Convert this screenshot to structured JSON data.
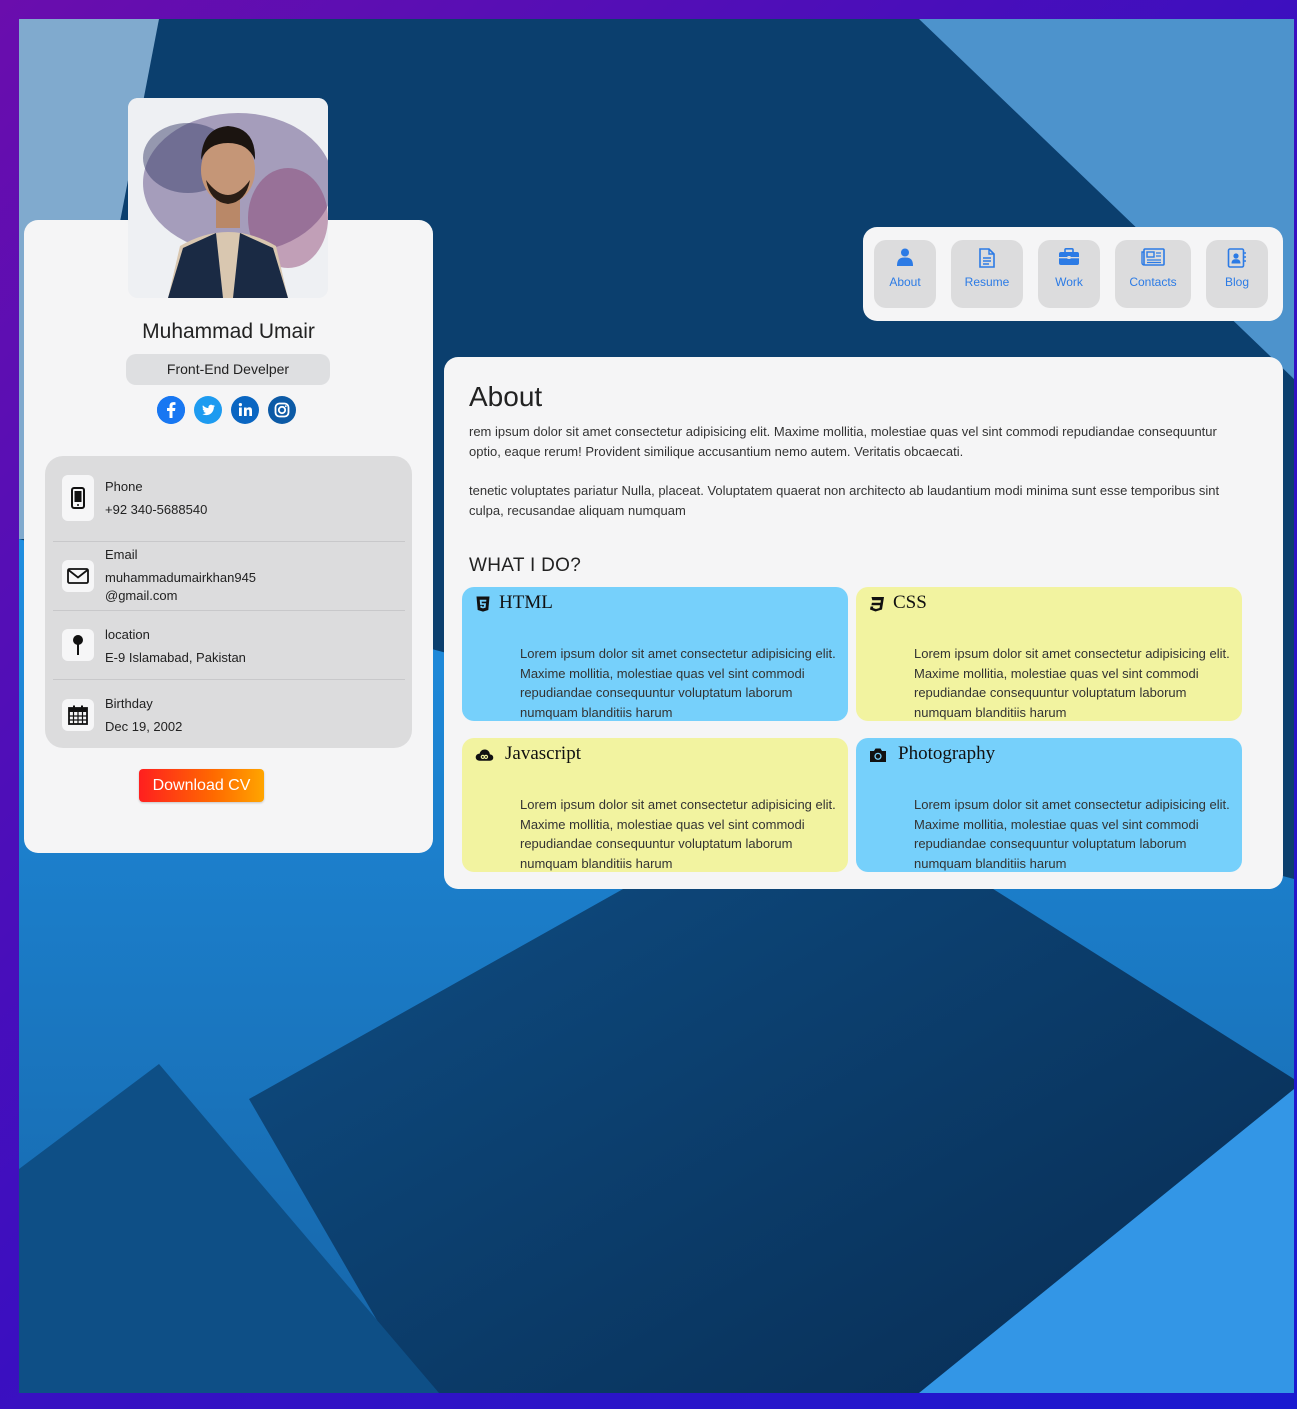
{
  "profile": {
    "name": "Muhammad Umair",
    "role": "Front-End Develper",
    "socials": [
      "facebook-icon",
      "twitter-icon",
      "linkedin-icon",
      "instagram-icon"
    ],
    "contacts": [
      {
        "label": "Phone",
        "value": "+92 340-5688540",
        "icon": "phone-icon"
      },
      {
        "label": "Email",
        "value": "muhammadumairkhan945\n@gmail.com",
        "icon": "envelope-icon"
      },
      {
        "label": "location",
        "value": "E-9 Islamabad, Pakistan",
        "icon": "map-pin-icon"
      },
      {
        "label": "Birthday",
        "value": "Dec 19, 2002",
        "icon": "calendar-icon"
      }
    ],
    "download_label": "Download CV"
  },
  "nav": {
    "items": [
      {
        "label": "About",
        "icon": "user-icon"
      },
      {
        "label": "Resume",
        "icon": "document-icon"
      },
      {
        "label": "Work",
        "icon": "briefcase-icon"
      },
      {
        "label": "Contacts",
        "icon": "newspaper-icon"
      },
      {
        "label": "Blog",
        "icon": "contact-book-icon"
      }
    ]
  },
  "about": {
    "title": "About",
    "para1": "rem ipsum dolor sit amet consectetur adipisicing elit. Maxime mollitia, molestiae quas vel sint commodi repudiandae consequuntur optio, eaque rerum! Provident similique accusantium nemo autem. Veritatis obcaecati.",
    "para2": "tenetic voluptates pariatur Nulla, placeat. Voluptatem quaerat non architecto ab laudantium modi minima sunt esse temporibus sint culpa, recusandae aliquam numquam",
    "whatido": "WHAT I DO?",
    "skills": [
      {
        "title": "HTML",
        "icon": "html5-icon",
        "text": "Lorem ipsum dolor sit amet consectetur adipisicing elit. Maxime mollitia, molestiae quas vel sint commodi repudiandae consequuntur voluptatum laborum numquam blanditiis harum",
        "color": "#76d0fb"
      },
      {
        "title": "CSS",
        "icon": "css3-icon",
        "text": "Lorem ipsum dolor sit amet consectetur adipisicing elit. Maxime mollitia, molestiae quas vel sint commodi repudiandae consequuntur voluptatum laborum numquam blanditiis harum",
        "color": "#f2f3a0"
      },
      {
        "title": "Javascript",
        "icon": "cloud-icon",
        "text": "Lorem ipsum dolor sit amet consectetur adipisicing elit. Maxime mollitia, molestiae quas vel sint commodi repudiandae consequuntur voluptatum laborum numquam blanditiis harum",
        "color": "#f2f3a0"
      },
      {
        "title": "Photography",
        "icon": "camera-icon",
        "text": "Lorem ipsum dolor sit amet consectetur adipisicing elit. Maxime mollitia, molestiae quas vel sint commodi repudiandae consequuntur voluptatum laborum numquam blanditiis harum",
        "color": "#76d0fb"
      }
    ]
  },
  "colors": {
    "accent": "#2c7be5",
    "skill_blue": "#76d0fb",
    "skill_yellow": "#f2f3a0",
    "facebook": "#1877f2",
    "twitter": "#1d9bf0",
    "linkedin": "#0a66c2",
    "instagram": "#0c5aa6"
  }
}
